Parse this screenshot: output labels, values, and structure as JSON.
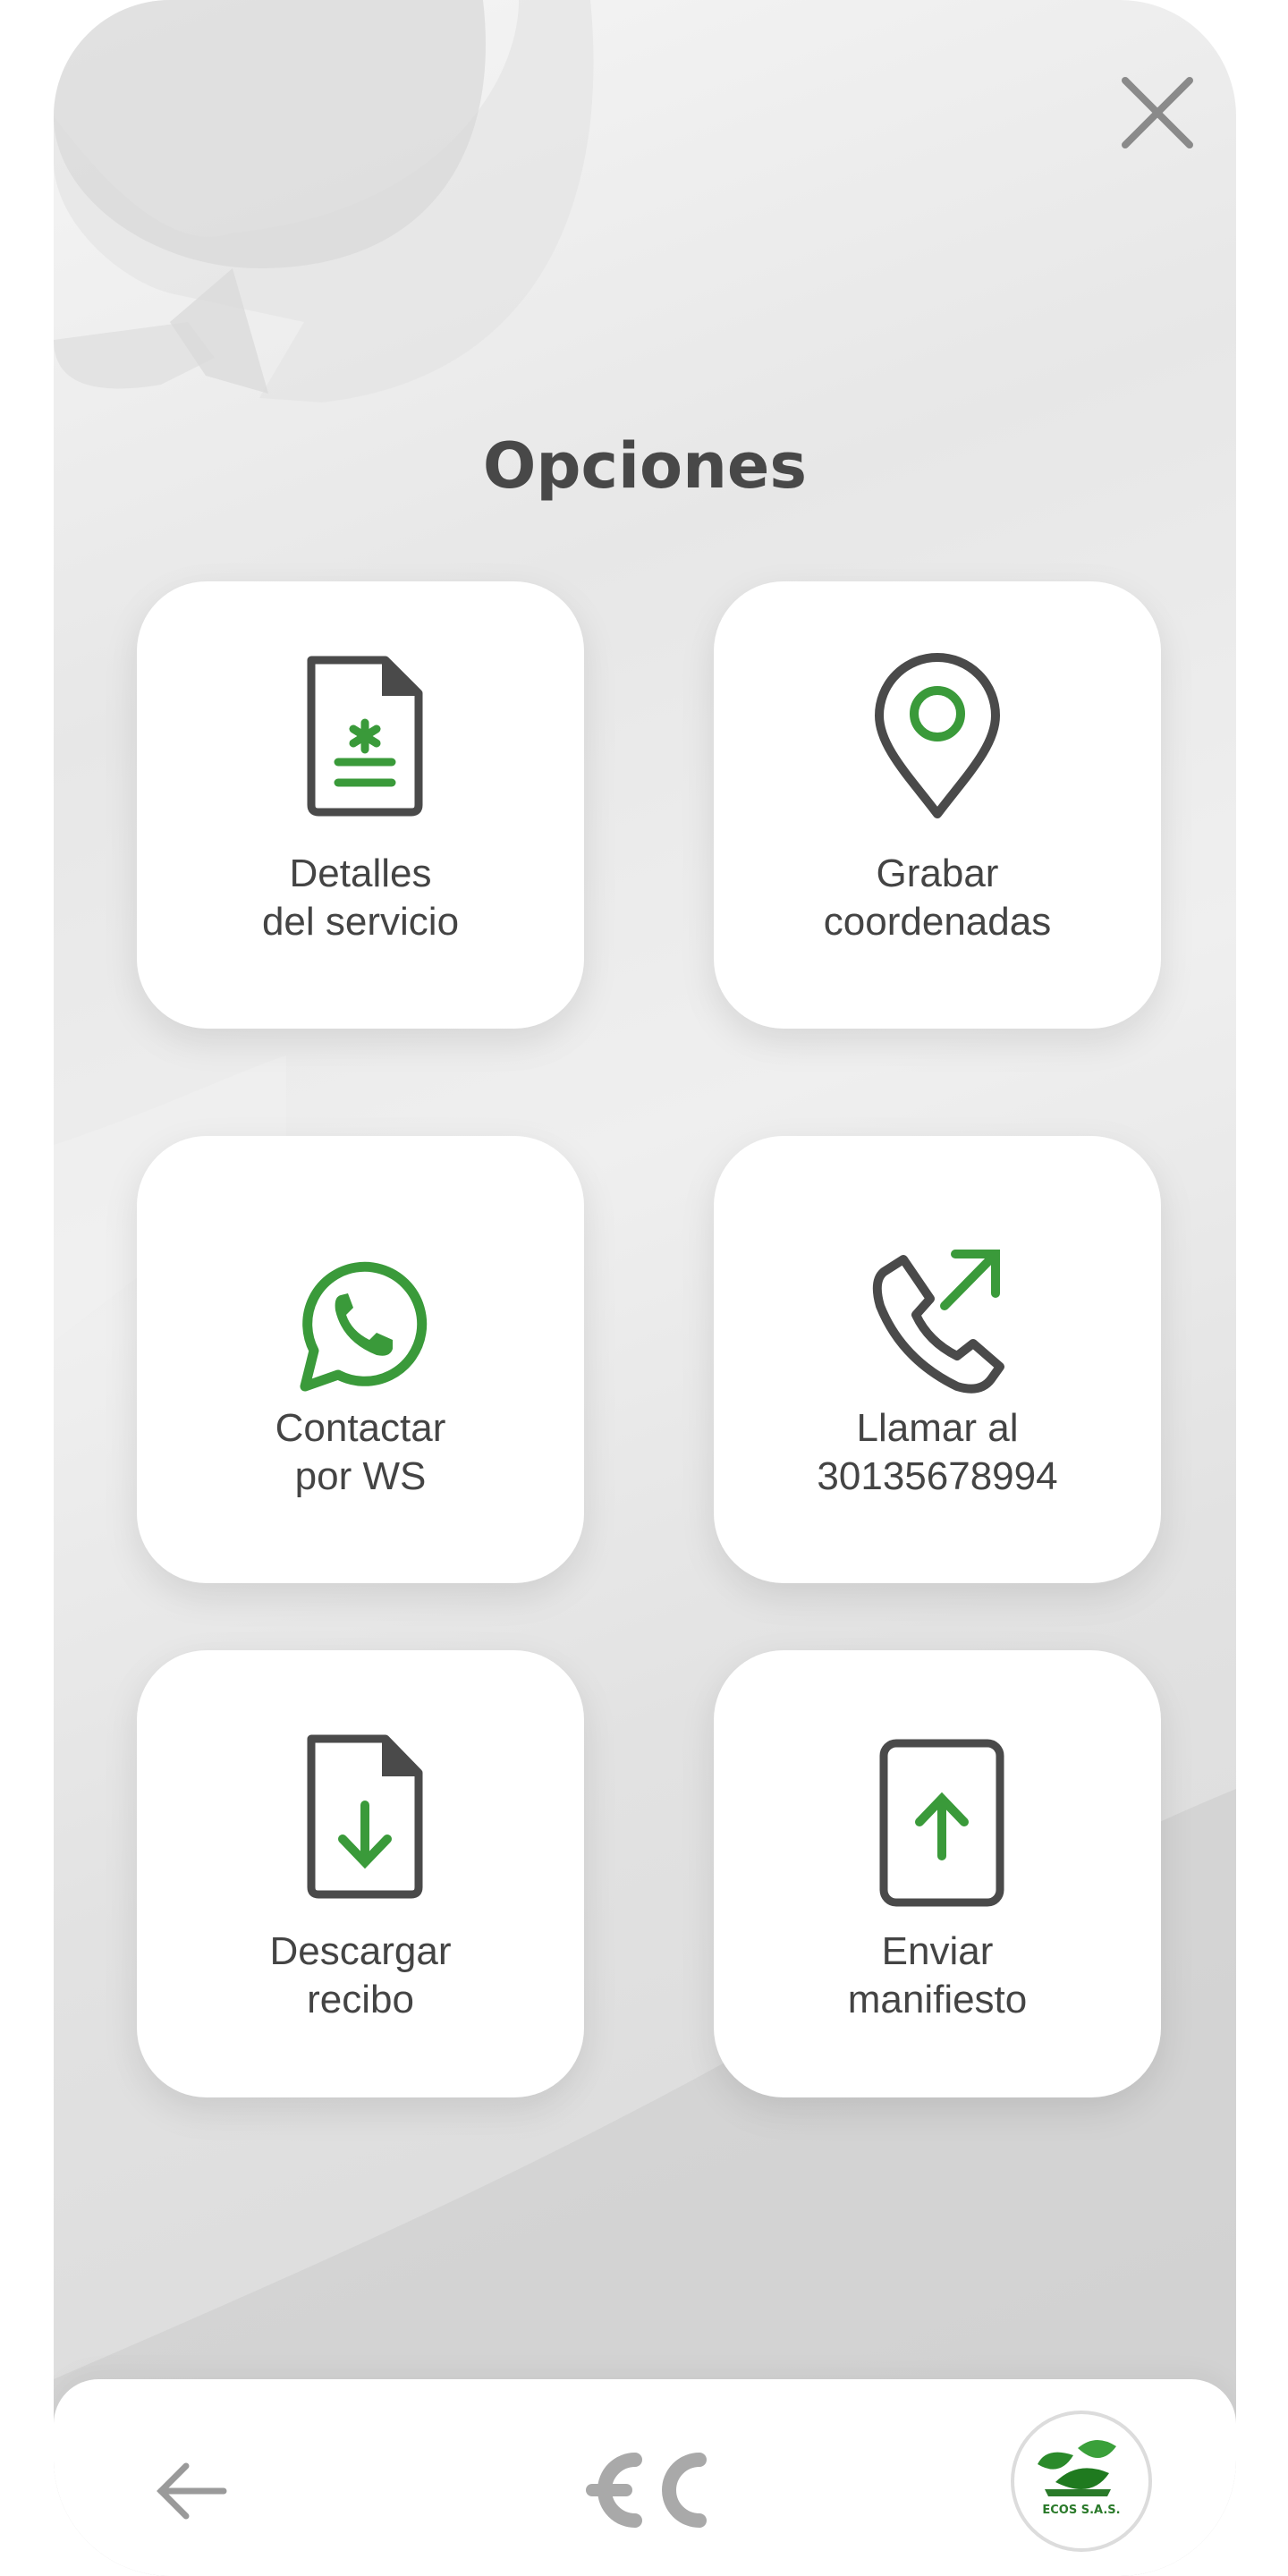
{
  "header": {
    "title": "Opciones",
    "close_icon": "close-icon"
  },
  "options": [
    {
      "line1": "Detalles",
      "line2": "del servicio",
      "icon": "document-medical-icon"
    },
    {
      "line1": "Grabar",
      "line2": "coordenadas",
      "icon": "location-pin-icon"
    },
    {
      "line1": "Contactar",
      "line2": "por WS",
      "icon": "whatsapp-icon"
    },
    {
      "line1": "Llamar al",
      "line2": "30135678994",
      "icon": "phone-outgoing-icon"
    },
    {
      "line1": "Descargar",
      "line2": "recibo",
      "icon": "document-download-icon"
    },
    {
      "line1": "Enviar",
      "line2": "manifiesto",
      "icon": "phone-upload-icon"
    }
  ],
  "bottom_nav": {
    "back_icon": "arrow-left-icon",
    "home_icon": "app-logo-icon",
    "brand_text": "ECOS S.A.S."
  },
  "colors": {
    "accent": "#3a9a3a",
    "icon_dark": "#4a4a4a",
    "text": "#444444"
  }
}
